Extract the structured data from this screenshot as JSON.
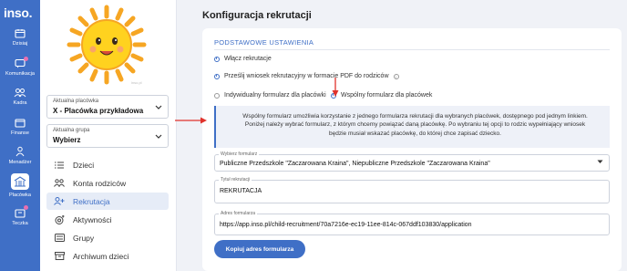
{
  "brand": {
    "logo": "inso."
  },
  "rail": {
    "items": [
      {
        "label": "Dzisiaj",
        "icon": "calendar-icon"
      },
      {
        "label": "Komunikacja",
        "icon": "chat-icon"
      },
      {
        "label": "Kadra",
        "icon": "people-icon"
      },
      {
        "label": "Finanse",
        "icon": "wallet-icon"
      },
      {
        "label": "Menadżer",
        "icon": "manager-icon"
      },
      {
        "label": "Placówka",
        "icon": "building-icon"
      },
      {
        "label": "Teczka",
        "icon": "folder-icon"
      }
    ],
    "active_index": 5,
    "dot_color": "#e86fb0"
  },
  "sidebar": {
    "sun_caption": "inso.pl",
    "facility_select": {
      "label": "Aktualna placówka",
      "value": "X - Placówka przykładowa"
    },
    "group_select": {
      "label": "Aktualna grupa",
      "value": "Wybierz"
    },
    "nav": [
      {
        "label": "Dzieci",
        "icon": "list-icon"
      },
      {
        "label": "Konta rodziców",
        "icon": "parents-icon"
      },
      {
        "label": "Rekrutacja",
        "icon": "add-person-icon",
        "active": true
      },
      {
        "label": "Aktywności",
        "icon": "activities-icon"
      },
      {
        "label": "Grupy",
        "icon": "groups-icon"
      },
      {
        "label": "Archiwum dzieci",
        "icon": "archive-icon"
      }
    ]
  },
  "main": {
    "title": "Konfiguracja rekrutacji",
    "section_title": "PODSTAWOWE USTAWIENIA",
    "enable_label": "Włącz rekrutacje",
    "pdf_label": "Prześlij wniosek rekrutacyjny w formacie PDF do rodziców",
    "form_type": {
      "individual": "Indywidualny formularz dla placówki",
      "shared": "Wspólny formularz dla placówek",
      "selected": "shared"
    },
    "note_lines": [
      "Wspólny formularz umożliwia korzystanie z jednego formularza rekrutacji dla wybranych placówek, dostępnego pod jednym linkiem.",
      "Poniżej należy wybrać formularz, z którym chcemy powiązać daną placówkę. Po wybraniu tej opcji to rodzic wypełniający wniosek",
      "będzie musiał wskazać placówkę, do której chce zapisać dziecko."
    ],
    "form_select": {
      "label": "Wybierz formularz",
      "value": "Publiczne Przedszkole \"Zaczarowana Kraina\", Niepubliczne Przedszkole \"Zaczarowana Kraina\""
    },
    "title_field": {
      "label": "Tytuł rekrutacji",
      "value": "REKRUTACJA"
    },
    "address_field": {
      "label": "Adres formularza",
      "value": "https://app.inso.pl/child-recruitment/70a7216e-ec19-11ee-814c-067ddf103830/application"
    },
    "copy_button": "Kopiuj adres formularza"
  },
  "colors": {
    "accent": "#3f6fc6",
    "annotation": "#e0322c"
  }
}
